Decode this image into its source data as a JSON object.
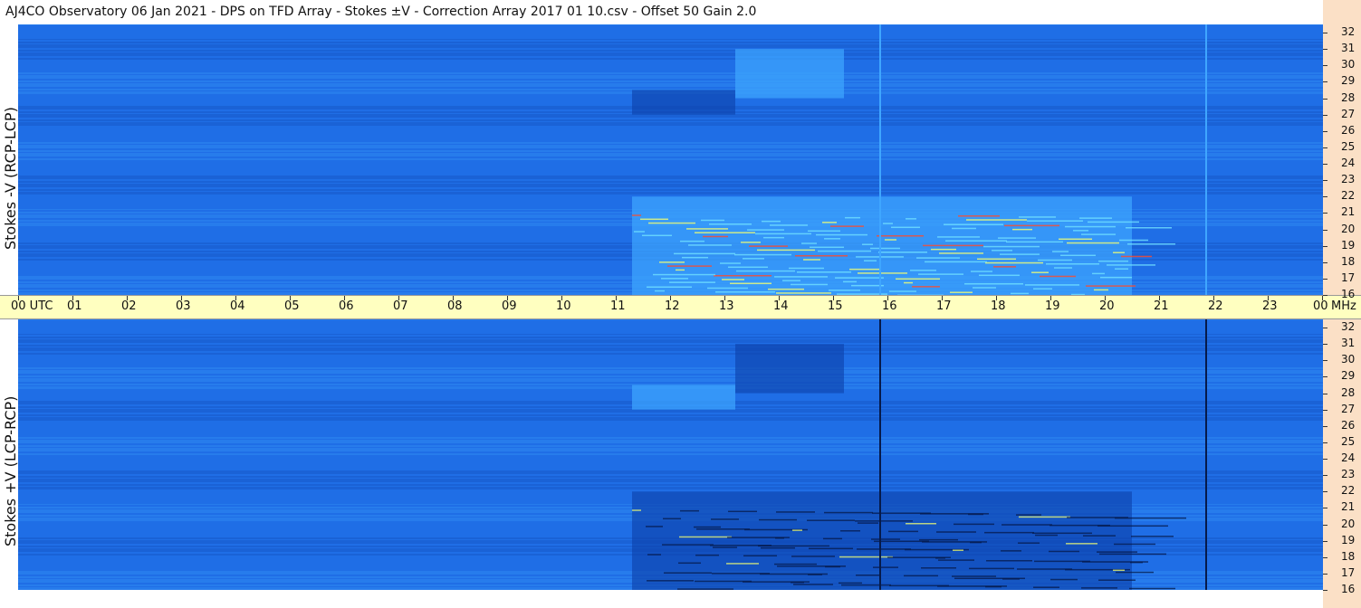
{
  "header": {
    "title": "AJ4CO Observatory  06 Jan 2021  -  DPS on TFD Array  -  Stokes ±V  -  Correction Array 2017 01 10.csv  -  Offset 50  Gain 2.0"
  },
  "time_axis": {
    "labels": [
      "00 UTC",
      "01",
      "02",
      "03",
      "04",
      "05",
      "06",
      "07",
      "08",
      "09",
      "10",
      "11",
      "12",
      "13",
      "14",
      "15",
      "16",
      "17",
      "18",
      "19",
      "20",
      "21",
      "22",
      "23",
      "00"
    ],
    "unit_label": "MHz"
  },
  "colors": {
    "background_blue": "#1f6ee6",
    "dark_blue": "#0c3fa8",
    "light_blue": "#3fa6ff",
    "cyan": "#6fe0ff",
    "yellow": "#f4ff70",
    "timebar": "#ffffc0",
    "right_strip": "#fbe0c6"
  },
  "chart_data": [
    {
      "type": "heatmap",
      "title": "",
      "ylabel": "Stokes -V (RCP-LCP)",
      "xlabel": "",
      "x_range_hours_utc": [
        0,
        24
      ],
      "ylim": [
        16,
        32
      ],
      "y_ticks": [
        "32",
        "31",
        "30",
        "29",
        "28",
        "27",
        "26",
        "25",
        "24",
        "23",
        "22",
        "21",
        "20",
        "19",
        "18",
        "17",
        "16"
      ],
      "colormap": "blue-cyan-yellow-red",
      "features": [
        {
          "kind": "bright emission band",
          "hours": [
            11.3,
            20.5
          ],
          "mhz": [
            16,
            22
          ]
        },
        {
          "kind": "dark block",
          "hours": [
            11.3,
            13.2
          ],
          "mhz": [
            27,
            28.5
          ]
        },
        {
          "kind": "bright block",
          "hours": [
            13.2,
            15.2
          ],
          "mhz": [
            28,
            31
          ]
        },
        {
          "kind": "vertical line",
          "hours": [
            15.85
          ]
        },
        {
          "kind": "vertical line",
          "hours": [
            21.85
          ]
        }
      ]
    },
    {
      "type": "heatmap",
      "title": "",
      "ylabel": "Stokes +V (LCP-RCP)",
      "xlabel": "",
      "x_range_hours_utc": [
        0,
        24
      ],
      "ylim": [
        16,
        32
      ],
      "y_ticks": [
        "32",
        "31",
        "30",
        "29",
        "28",
        "27",
        "26",
        "25",
        "24",
        "23",
        "22",
        "21",
        "20",
        "19",
        "18",
        "17",
        "16"
      ],
      "colormap": "blue-cyan-yellow-red",
      "features": [
        {
          "kind": "dark absorption band",
          "hours": [
            11.3,
            20.5
          ],
          "mhz": [
            16,
            22
          ]
        },
        {
          "kind": "bright block",
          "hours": [
            11.3,
            13.2
          ],
          "mhz": [
            27,
            28.5
          ]
        },
        {
          "kind": "dark block",
          "hours": [
            13.2,
            15.2
          ],
          "mhz": [
            28,
            31
          ]
        },
        {
          "kind": "vertical line",
          "hours": [
            15.85
          ]
        },
        {
          "kind": "vertical line",
          "hours": [
            21.85
          ]
        }
      ]
    }
  ]
}
